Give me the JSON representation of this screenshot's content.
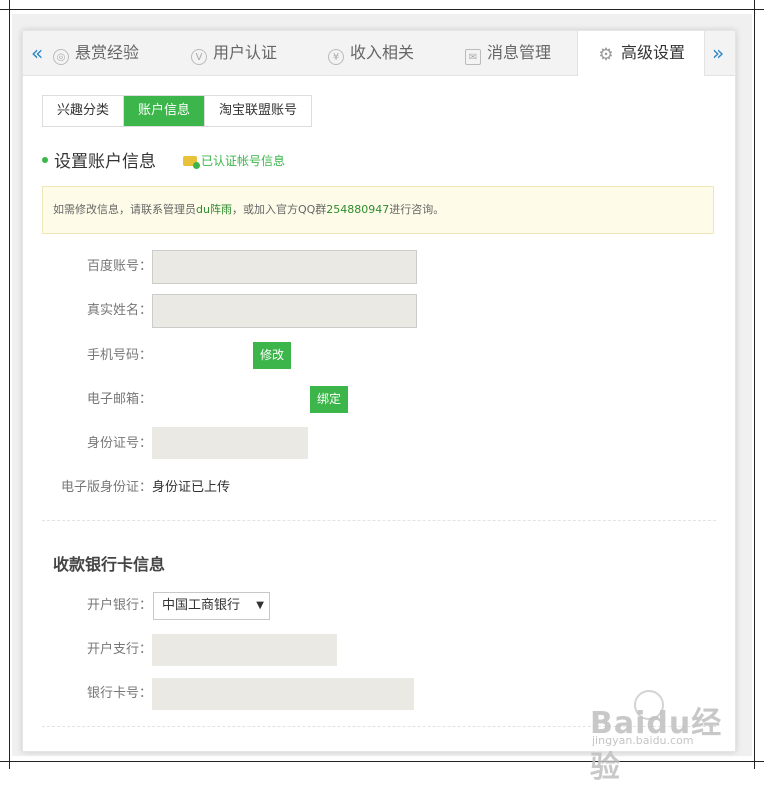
{
  "tabs": {
    "prev_arrow": "«",
    "next_arrow": "»",
    "items": [
      {
        "label": "悬赏经验",
        "icon": "coin-icon"
      },
      {
        "label": "用户认证",
        "icon": "v-badge-icon"
      },
      {
        "label": "收入相关",
        "icon": "yen-icon"
      },
      {
        "label": "消息管理",
        "icon": "mail-icon"
      },
      {
        "label": "高级设置",
        "icon": "gear-icon",
        "active": true
      }
    ]
  },
  "subtabs": [
    "兴趣分类",
    "账户信息",
    "淘宝联盟账号"
  ],
  "subtab_active_index": 1,
  "account": {
    "title": "设置账户信息",
    "verified_label": "已认证帐号信息",
    "notice": {
      "prefix": "如需修改信息，请联系管理员",
      "admin": "du阵雨",
      "middle": "，或加入官方QQ群",
      "qq": "254880947",
      "suffix": "进行咨询。"
    },
    "fields": {
      "baidu_label": "百度账号：",
      "realname_label": "真实姓名：",
      "phone_label": "手机号码：",
      "phone_button": "修改",
      "email_label": "电子邮箱：",
      "email_button": "绑定",
      "idcard_label": "身份证号：",
      "eidcard_label": "电子版身份证：",
      "eidcard_value": "身份证已上传"
    }
  },
  "bank": {
    "title": "收款银行卡信息",
    "bank_label": "开户银行：",
    "bank_value": "中国工商银行",
    "branch_label": "开户支行：",
    "card_label": "银行卡号："
  },
  "watermark": {
    "brand": "Baidu经验",
    "url": "jingyan.baidu.com"
  },
  "colors": {
    "accent": "#3cb54a",
    "link": "#2d86c7",
    "notice_bg": "#fefce8",
    "field_bg": "#ebe9e4"
  }
}
